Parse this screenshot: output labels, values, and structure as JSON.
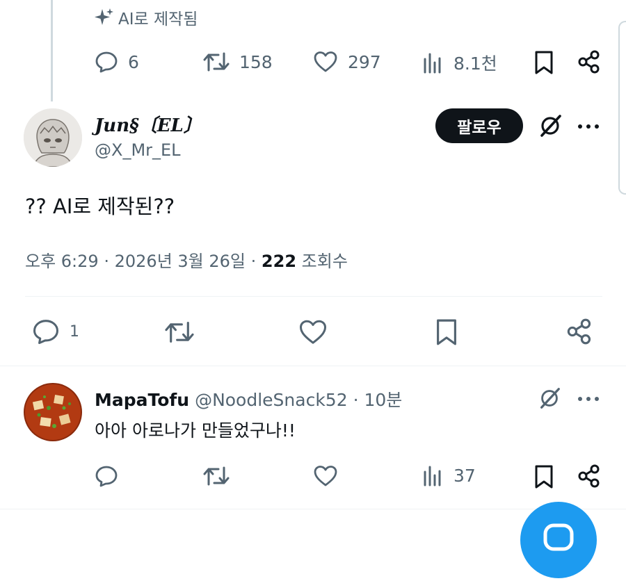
{
  "top_tweet": {
    "ai_badge": "AI로 제작됨",
    "stats": {
      "replies": "6",
      "reposts": "158",
      "likes": "297",
      "views": "8.1천"
    }
  },
  "main_tweet": {
    "display_name": "Jun§〔EL〕",
    "handle": "@X_Mr_EL",
    "follow_label": "팔로우",
    "text": "?? AI로 제작된??",
    "time": "오후 6:29",
    "date": "2026년 3월 26일",
    "views_count": "222",
    "views_label": "조회수",
    "separator": "·",
    "stats": {
      "replies": "1"
    }
  },
  "reply": {
    "display_name": "MapaTofu",
    "handle": "@NoodleSnack52",
    "separator": "·",
    "time_ago": "10분",
    "text": "아아 아로나가 만들었구나!!",
    "stats": {
      "views": "37"
    }
  },
  "colors": {
    "accent": "#1d9bf0",
    "text": "#0f1419",
    "muted": "#536471",
    "border": "#eff3f4"
  }
}
